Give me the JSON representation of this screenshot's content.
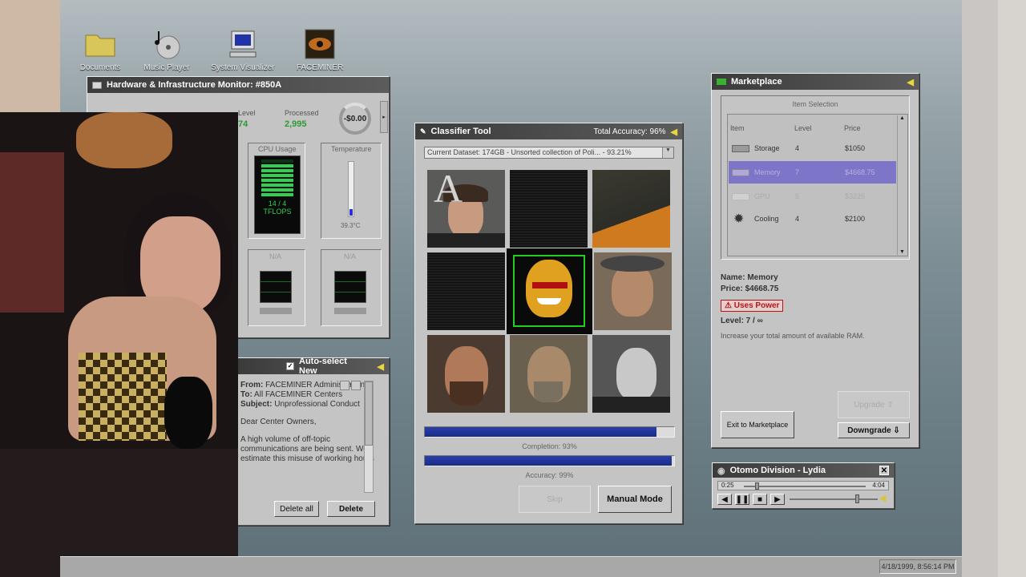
{
  "desktop": {
    "icons": [
      {
        "label": "Documents"
      },
      {
        "label": "Music Player"
      },
      {
        "label": "System Visualizer"
      },
      {
        "label": "FACEMINER"
      }
    ]
  },
  "monitor": {
    "title": "Hardware & Infrastructure Monitor: #850A",
    "level_label": "Level",
    "level": "74",
    "processed_label": "Processed",
    "processed": "2,995",
    "balance": "-$0.00",
    "cpu_label": "CPU Usage",
    "cpu_value": "14 / 4",
    "cpu_unit": "TFLOPS",
    "temp_label": "Temperature",
    "temp_value": "39.3°C",
    "temp_level": 0.12,
    "na1": "N/A",
    "na2": "N/A"
  },
  "classifier": {
    "title": "Classifier Tool",
    "accuracy_label": "Total Accuracy: 96%",
    "dataset": "Current Dataset: 174GB - Unsorted collection of Poli... - 93.21%",
    "overlay_letter": "A",
    "completion_label": "Completion: 93%",
    "completion": 0.93,
    "accuracy_bar_label": "Accuracy: 99%",
    "accuracy": 0.99,
    "skip_label": "Skip",
    "manual_label": "Manual Mode"
  },
  "mail": {
    "auto_select_label": "Auto-select New",
    "from_label": "From:",
    "from": "FACEMINER Administration",
    "to_label": "To:",
    "to": "All FACEMINER Centers",
    "subject_label": "Subject:",
    "subject": "Unprofessional Conduct",
    "greeting": "Dear Center Owners,",
    "body": "A high volume of off-topic communications are being sent. We estimate this misuse of working hours has reduced",
    "delete_all_label": "Delete all",
    "delete_label": "Delete"
  },
  "marketplace": {
    "title": "Marketplace",
    "section": "Item Selection",
    "columns": [
      "Item",
      "Level",
      "Price"
    ],
    "items": [
      {
        "name": "Storage",
        "level": "4",
        "price": "$1050",
        "selected": false
      },
      {
        "name": "Memory",
        "level": "7",
        "price": "$4668.75",
        "selected": true
      },
      {
        "name": "GPU",
        "level": "5",
        "price": "$3225",
        "selected": false
      },
      {
        "name": "Cooling",
        "level": "4",
        "price": "$2100",
        "selected": false
      }
    ],
    "detail_name": "Name: Memory",
    "detail_price": "Price: $4668.75",
    "badge": "⚠ Uses Power",
    "detail_level": "Level: 7 / ∞",
    "description": "Increase your total amount of available RAM.",
    "exit_label": "Exit to Marketplace",
    "upgrade_label": "Upgrade ⇧",
    "downgrade_label": "Downgrade ⇩"
  },
  "player": {
    "title": "Otomo Division - Lydia",
    "elapsed": "0:25",
    "total": "4:04",
    "progress": 0.09,
    "volume": 0.78
  },
  "taskbar": {
    "clock": "4/18/1999, 8:56:14 PM"
  },
  "colors": {
    "accent": "#1f3390",
    "selected_row": "#7d76c8",
    "warning": "#b01818",
    "titlebar": "#3b3b3b"
  }
}
